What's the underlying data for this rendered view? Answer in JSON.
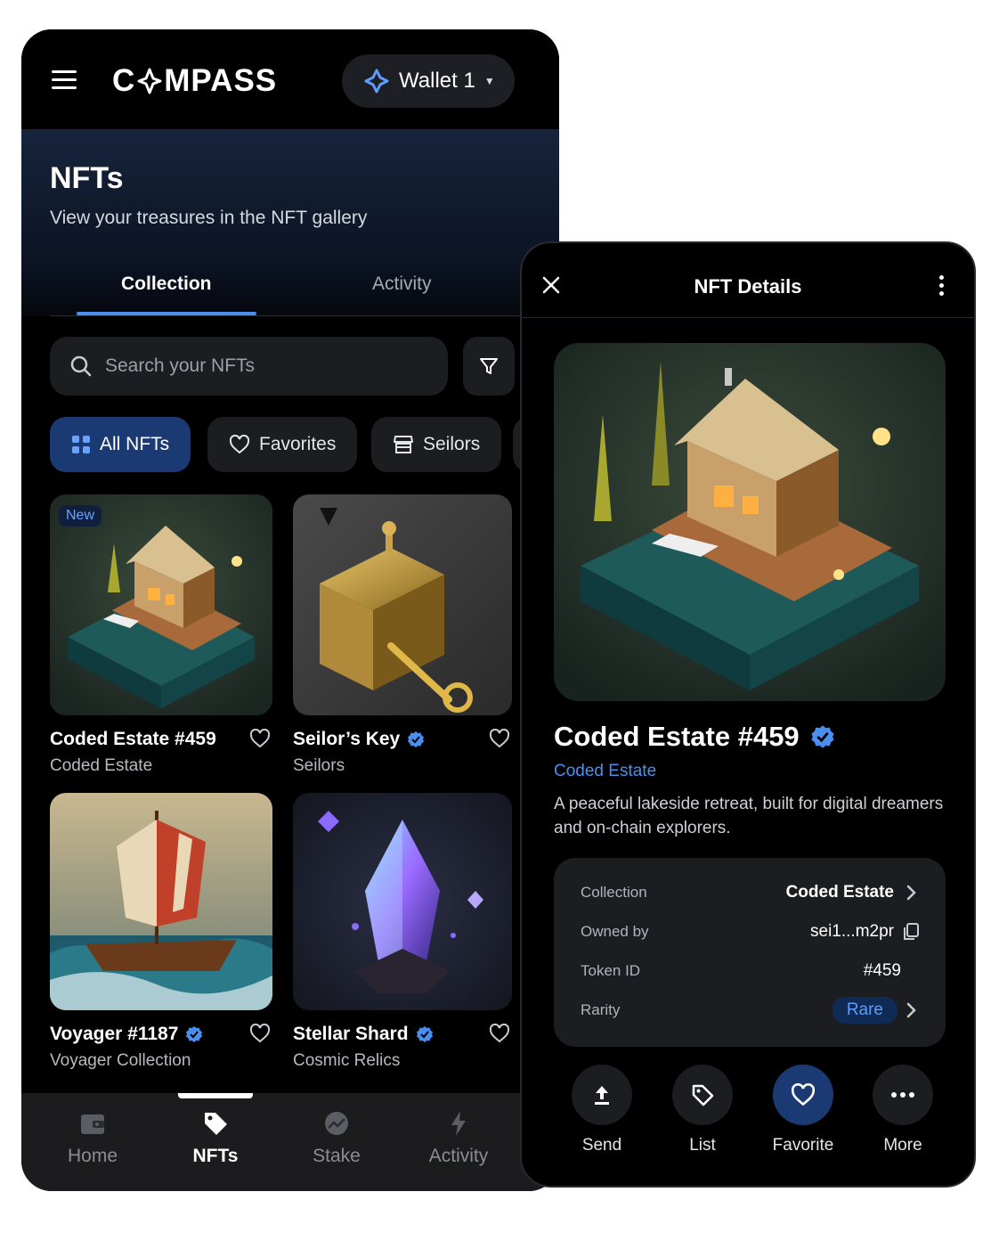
{
  "app": {
    "logo_text_left": "C",
    "logo_text_right": "MPASS",
    "wallet_label": "Wallet 1"
  },
  "header": {
    "title": "NFTs",
    "subtitle": "View your treasures in the NFT gallery"
  },
  "tabs": [
    {
      "label": "Collection",
      "active": true
    },
    {
      "label": "Activity",
      "active": false
    }
  ],
  "search": {
    "placeholder": "Search your NFTs"
  },
  "chips": [
    {
      "label": "All NFTs",
      "active": true
    },
    {
      "label": "Favorites",
      "active": false
    },
    {
      "label": "Seilors",
      "active": false
    }
  ],
  "nfts": [
    {
      "title": "Coded Estate #459",
      "collection": "Coded Estate",
      "verified": false,
      "badge": "New"
    },
    {
      "title": "Seilor’s Key",
      "collection": "Seilors",
      "verified": true
    },
    {
      "title": "Voyager #1187",
      "collection": "Voyager Collection",
      "verified": true
    },
    {
      "title": "Stellar Shard",
      "collection": "Cosmic Relics",
      "verified": true
    }
  ],
  "bottom_nav": [
    {
      "label": "Home",
      "active": false
    },
    {
      "label": "NFTs",
      "active": true
    },
    {
      "label": "Stake",
      "active": false
    },
    {
      "label": "Activity",
      "active": false
    }
  ],
  "detail": {
    "header_title": "NFT Details",
    "name": "Coded Estate #459",
    "collection_link": "Coded Estate",
    "description": "A peaceful lakeside retreat, built for digital dreamers and on-chain explorers.",
    "info": [
      {
        "key": "Collection",
        "value": "Coded Estate"
      },
      {
        "key": "Owned by",
        "value": "sei1...m2pr"
      },
      {
        "key": "Token ID",
        "value": "#459"
      },
      {
        "key": "Rarity",
        "value": "Rare"
      }
    ],
    "actions": [
      "Send",
      "List",
      "Favorite",
      "More"
    ]
  },
  "colors": {
    "accent_blue": "#4a8ff0",
    "chip_active": "#1b3a73",
    "surface": "#1c1d21",
    "background": "#000000"
  }
}
